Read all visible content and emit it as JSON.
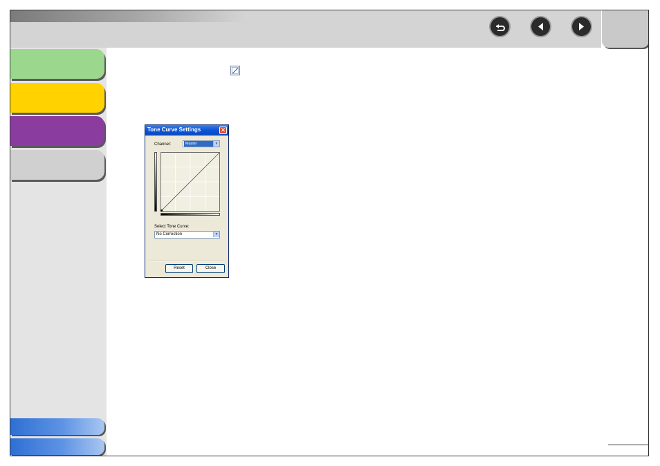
{
  "colors": {
    "topbar": "#d4d4d4",
    "sidebar": "#e4e4e4",
    "tab_green": "#9bd88e",
    "tab_yellow": "#ffd200",
    "tab_purple": "#8a3c9f",
    "tab_gray": "#d0d0d0",
    "bottom_tabs": "#2f6fd3",
    "dialog_title": "#0a55d6"
  },
  "nav": {
    "back_icon": "return-arrow-icon",
    "prev_icon": "triangle-left-icon",
    "next_icon": "triangle-right-icon"
  },
  "inline_icon": "tone-curve-icon",
  "dialog": {
    "title": "Tone Curve Settings",
    "close_glyph": "✕",
    "channel_label": "Channel:",
    "channel_value": "Master",
    "select_label": "Select Tone Curve:",
    "tone_curve_value": "No Correction",
    "reset_button": "Reset",
    "close_button": "Close",
    "curve_type": "linear"
  }
}
